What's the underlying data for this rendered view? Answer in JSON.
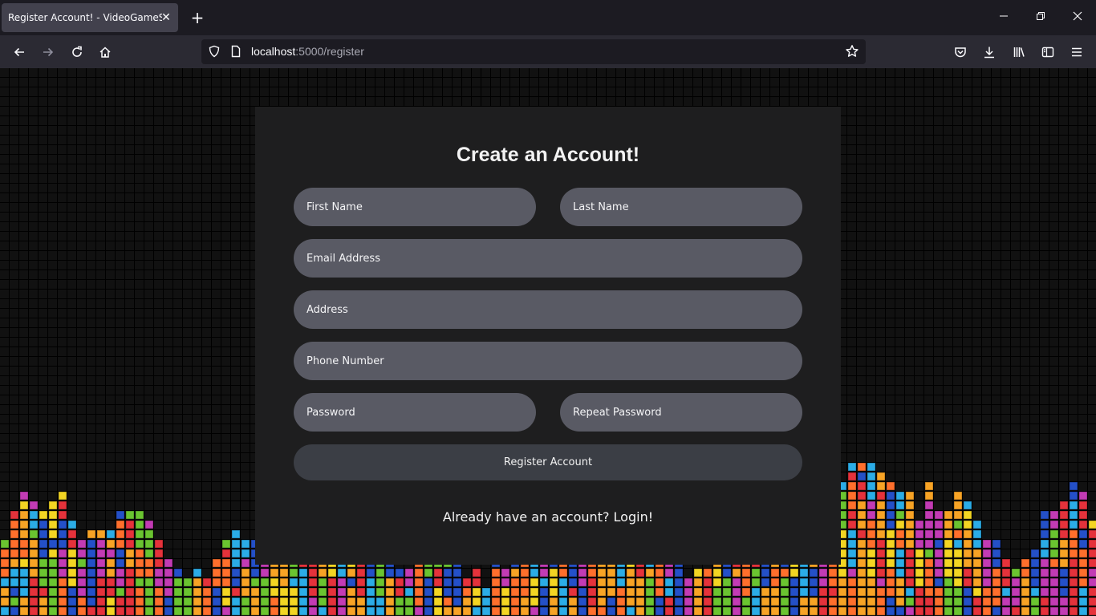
{
  "browser": {
    "tab_title": "Register Account! - VideoGameShop",
    "tab_close": "✕",
    "new_tab": "+",
    "url_host": "localhost",
    "url_path": ":5000/register",
    "icons": [
      "back-icon",
      "forward-icon",
      "reload-icon",
      "home-icon",
      "shield-icon",
      "page-icon",
      "star-icon",
      "pocket-icon",
      "download-icon",
      "library-icon",
      "sidebar-icon",
      "menu-icon",
      "minimize-icon",
      "restore-icon",
      "close-icon"
    ]
  },
  "form": {
    "title": "Create an Account!",
    "first_name_placeholder": "First Name",
    "last_name_placeholder": "Last Name",
    "email_placeholder": "Email Address",
    "address_placeholder": "Address",
    "phone_placeholder": "Phone Number",
    "password_placeholder": "Password",
    "repeat_password_placeholder": "Repeat Password",
    "submit_label": "Register Account",
    "login_link": "Already have an account? Login!"
  },
  "colors": {
    "card_bg": "#1e1e1f",
    "field_bg": "#595a64",
    "button_bg": "#3b3e45",
    "tetris": [
      "#e5323b",
      "#f7a325",
      "#f3d523",
      "#6ac430",
      "#2bace6",
      "#2450c8",
      "#c23bb4",
      "#ff6f2c"
    ]
  }
}
